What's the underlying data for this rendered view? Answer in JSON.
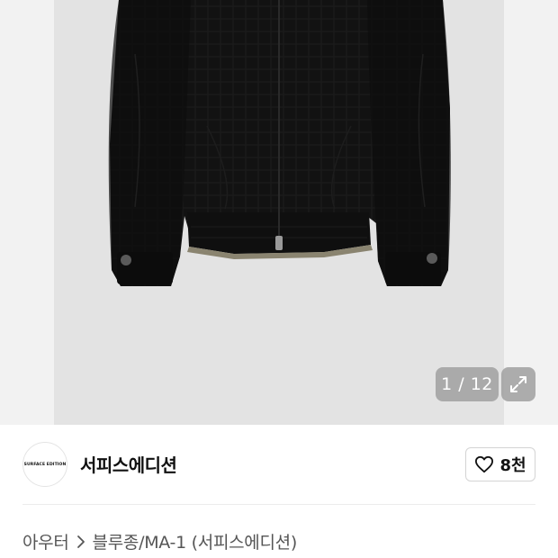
{
  "gallery": {
    "current_page": "1",
    "total_pages": "12",
    "counter_text": "1 / 12",
    "background_color": "#f2f2f2",
    "photo_background_color": "#e3e3e3",
    "product_color": "#111111",
    "expand_icon": "expand-arrows-icon"
  },
  "shop": {
    "logo_text": "SURFACE EDITION",
    "name": "서피스에디션",
    "like_icon": "heart-outline-icon",
    "like_count": "8천"
  },
  "breadcrumb": {
    "category": "아우터",
    "separator_icon": "chevron-right-icon",
    "subcategory": "블루종/MA-1 (서피스에디션)"
  }
}
